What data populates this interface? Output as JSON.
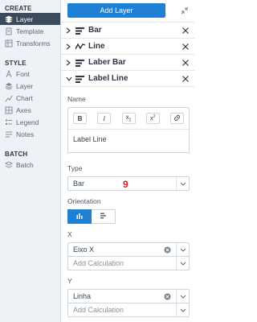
{
  "sidebar": {
    "create_heading": "CREATE",
    "create_items": [
      {
        "label": "Layer",
        "icon": "layers-icon",
        "active": true
      },
      {
        "label": "Template",
        "icon": "template-icon"
      },
      {
        "label": "Transforms",
        "icon": "transforms-icon"
      }
    ],
    "style_heading": "STYLE",
    "style_items": [
      {
        "label": "Font",
        "icon": "font-icon"
      },
      {
        "label": "Layer",
        "icon": "layers-icon"
      },
      {
        "label": "Chart",
        "icon": "chart-icon"
      },
      {
        "label": "Axes",
        "icon": "axes-icon"
      },
      {
        "label": "Legend",
        "icon": "legend-icon"
      },
      {
        "label": "Notes",
        "icon": "notes-icon"
      }
    ],
    "batch_heading": "BATCH",
    "batch_items": [
      {
        "label": "Batch",
        "icon": "batch-icon"
      }
    ]
  },
  "toolbar": {
    "add_layer_label": "Add Layer"
  },
  "layers": [
    {
      "name": "Bar",
      "icon": "bar-icon",
      "expanded": false
    },
    {
      "name": "Line",
      "icon": "line-icon",
      "expanded": false
    },
    {
      "name": "Laber Bar",
      "icon": "bar-icon",
      "expanded": false
    },
    {
      "name": "Label Line",
      "icon": "bar-icon",
      "expanded": true
    }
  ],
  "panel": {
    "name_label": "Name",
    "format_buttons": [
      "B",
      "I",
      "x2",
      "x2",
      "link"
    ],
    "name_value": "Label Line",
    "type_label": "Type",
    "type_value": "Bar",
    "type_annotation": "9",
    "orientation_label": "Orientation",
    "x_label": "X",
    "x_value": "Eixo X",
    "x_calc_placeholder": "Add Calculation",
    "y_label": "Y",
    "y_value": "Linha",
    "y_calc_placeholder": "Add Calculation"
  },
  "colors": {
    "accent": "#1f7fd4",
    "sidebar_bg": "#eef1f5",
    "sidebar_active": "#3c4a5c",
    "annotation": "#e0191b"
  }
}
